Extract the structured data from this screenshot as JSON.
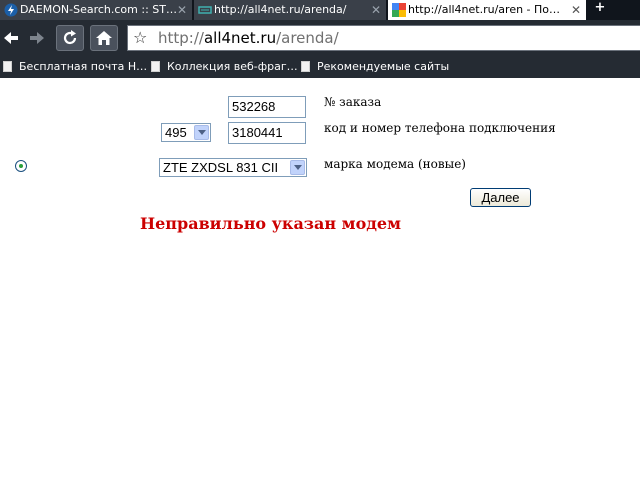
{
  "tabs": [
    {
      "title": "DAEMON-Search.com :: ST…",
      "icon": "daemon-lightning-icon",
      "active": false
    },
    {
      "title": "http://all4net.ru/arenda/",
      "icon": "page-icon",
      "active": false
    },
    {
      "title": "http://all4net.ru/aren - По…",
      "icon": "google-icon",
      "active": true
    }
  ],
  "toolbar": {
    "url_scheme": "http://",
    "url_host": "all4net.ru",
    "url_path": "/arenda/"
  },
  "bookmarks": [
    {
      "label": "Бесплатная почта Н…",
      "icon": "document-icon"
    },
    {
      "label": "Коллекция веб-фраг…",
      "icon": "document-icon"
    },
    {
      "label": "Рекомендуемые сайты",
      "icon": "document-icon"
    }
  ],
  "form": {
    "order_number": "532268",
    "order_label": "№ заказа",
    "area_code": "495",
    "phone_number": "3180441",
    "phone_label": "код и номер телефона подключения",
    "modem_value": "ZTE ZXDSL 831 CII",
    "modem_label": "марка модема (новые)",
    "next_button": "Далее",
    "error_message": "Неправильно указан модем"
  },
  "colors": {
    "error_text": "#cc0000",
    "tab_strip": "#10151c",
    "toolbar": "#252b33"
  }
}
